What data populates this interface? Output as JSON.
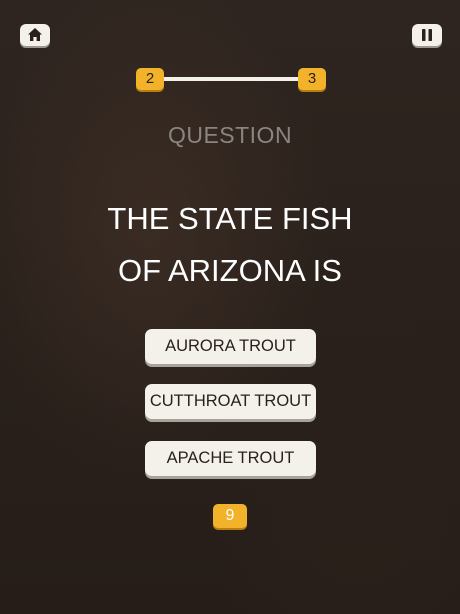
{
  "header": {
    "home_icon": "home-icon",
    "pause_icon": "pause-icon"
  },
  "progress": {
    "current_level": "2",
    "next_level": "3"
  },
  "question": {
    "label": "QUESTION",
    "text_lines": [
      "THE STATE FISH",
      "OF ARIZONA IS"
    ]
  },
  "answers": [
    {
      "label": "AURORA TROUT"
    },
    {
      "label": "CUTTHROAT TROUT"
    },
    {
      "label": "APACHE TROUT"
    }
  ],
  "timer": {
    "value": "9"
  },
  "colors": {
    "accent": "#f2b32a",
    "button_face": "#f4f1ea",
    "background": "#2a211c"
  }
}
